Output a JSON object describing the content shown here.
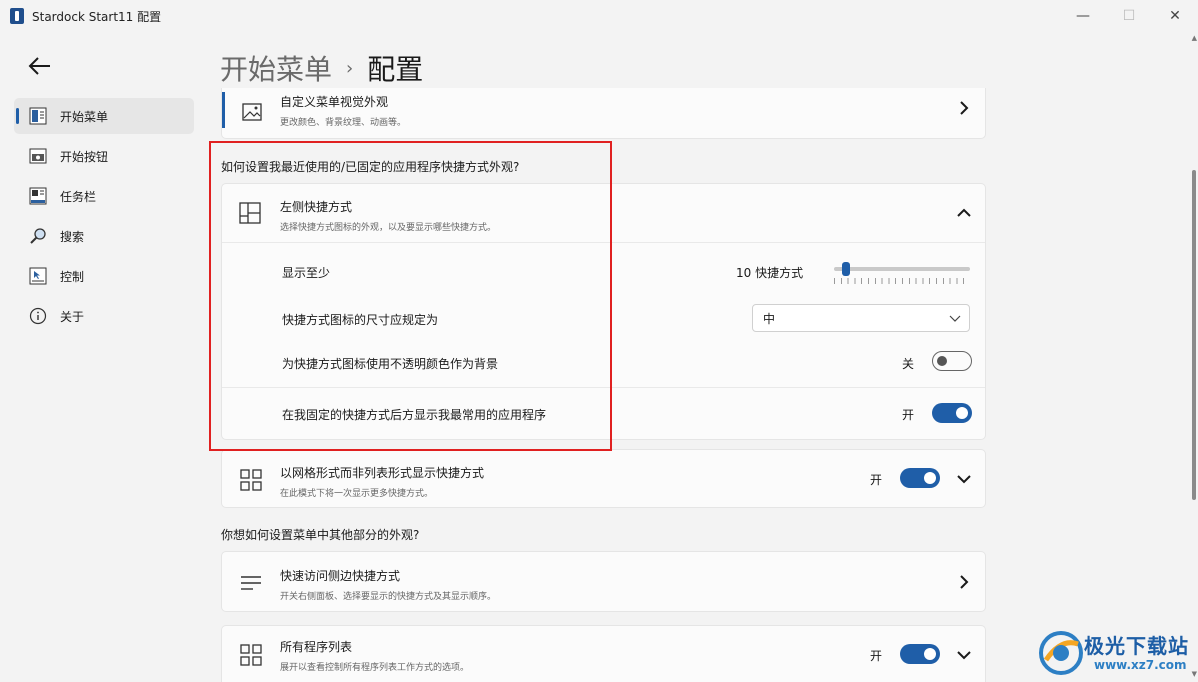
{
  "window": {
    "title": "Stardock Start11 配置"
  },
  "breadcrumb": {
    "parent": "开始菜单",
    "separator": "›",
    "current": "配置"
  },
  "sidebar": {
    "items": [
      {
        "label": "开始菜单",
        "icon": "start-menu-icon",
        "active": true
      },
      {
        "label": "开始按钮",
        "icon": "start-button-icon",
        "active": false
      },
      {
        "label": "任务栏",
        "icon": "taskbar-icon",
        "active": false
      },
      {
        "label": "搜索",
        "icon": "search-icon",
        "active": false
      },
      {
        "label": "控制",
        "icon": "control-icon",
        "active": false
      },
      {
        "label": "关于",
        "icon": "info-icon",
        "active": false
      }
    ]
  },
  "visual_card": {
    "title": "自定义菜单视觉外观",
    "desc": "更改颜色、背景纹理、动画等。",
    "icon": "image-icon"
  },
  "section1": {
    "label": "如何设置我最近使用的/已固定的应用程序快捷方式外观?"
  },
  "left_shortcuts": {
    "title": "左侧快捷方式",
    "desc": "选择快捷方式图标的外观，以及要显示哪些快捷方式。",
    "icon": "layout-icon",
    "show_at_least": {
      "label": "显示至少",
      "value_text": "10 快捷方式",
      "value": 10
    },
    "icon_size": {
      "label": "快捷方式图标的尺寸应规定为",
      "selected": "中"
    },
    "opaque_bg": {
      "label": "为快捷方式图标使用不透明颜色作为背景",
      "state_text": "关",
      "on": false
    },
    "show_frequent": {
      "label": "在我固定的快捷方式后方显示我最常用的应用程序",
      "state_text": "开",
      "on": true
    }
  },
  "grid_card": {
    "title": "以网格形式而非列表形式显示快捷方式",
    "desc": "在此模式下将一次显示更多快捷方式。",
    "state_text": "开",
    "on": true,
    "icon": "grid-icon"
  },
  "section2": {
    "label": "你想如何设置菜单中其他部分的外观?"
  },
  "quick_access_card": {
    "title": "快速访问侧边快捷方式",
    "desc": "开关右侧面板、选择要显示的快捷方式及其显示顺序。",
    "icon": "list-icon"
  },
  "all_programs_card": {
    "title": "所有程序列表",
    "desc": "展开以查看控制所有程序列表工作方式的选项。",
    "state_text": "开",
    "on": true,
    "icon": "grid-icon"
  },
  "watermark": {
    "name": "极光下载站",
    "url": "www.xz7.com"
  },
  "colors": {
    "accent": "#1f5ea8",
    "highlight": "#e02020"
  }
}
